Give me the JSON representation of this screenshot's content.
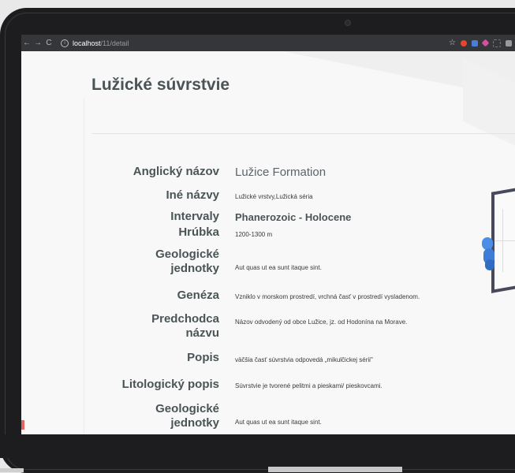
{
  "browser": {
    "url_host": "localhost",
    "url_path": "/11/detail",
    "back_glyph": "←",
    "forward_glyph": "→",
    "reload_glyph": "C",
    "info_glyph": "i",
    "star_glyph": "☆"
  },
  "page": {
    "title": "Lužické súvrstvie"
  },
  "details": [
    {
      "label": "Anglický názov",
      "value": "Lužice Formation"
    },
    {
      "label": "Iné názvy",
      "value": "Lužické vrstvy,Lužická séria"
    },
    {
      "label": "Intervaly",
      "value": "Phanerozoic - Holocene"
    },
    {
      "label": "Hrúbka",
      "value": "1200-1300 m"
    },
    {
      "label": "Geologické jednotky",
      "value": "Aut quas ut ea sunt itaque sint."
    },
    {
      "label": "Genéza",
      "value": "Vzniklo v morskom prostredí, vrchná časť v prostredí vysladenom."
    },
    {
      "label": "Predchodca názvu",
      "value": "Názov odvodený od obce Lužice, jz. od Hodonína na Morave."
    },
    {
      "label": "Popis",
      "value": "väčšia časť súvrstvia odpovedá „mikulčickej sérii\""
    },
    {
      "label": "Litologický popis",
      "value": "Súvrstvie je tvorené pelitmi a pieskami/ pieskovcami."
    },
    {
      "label": "Geologické jednotky",
      "value": "Aut quas ut ea sunt itaque sint."
    }
  ],
  "colors": {
    "heading": "#4a5456",
    "browser_bar": "#35363a",
    "laptop_body": "#1d1d1f"
  }
}
